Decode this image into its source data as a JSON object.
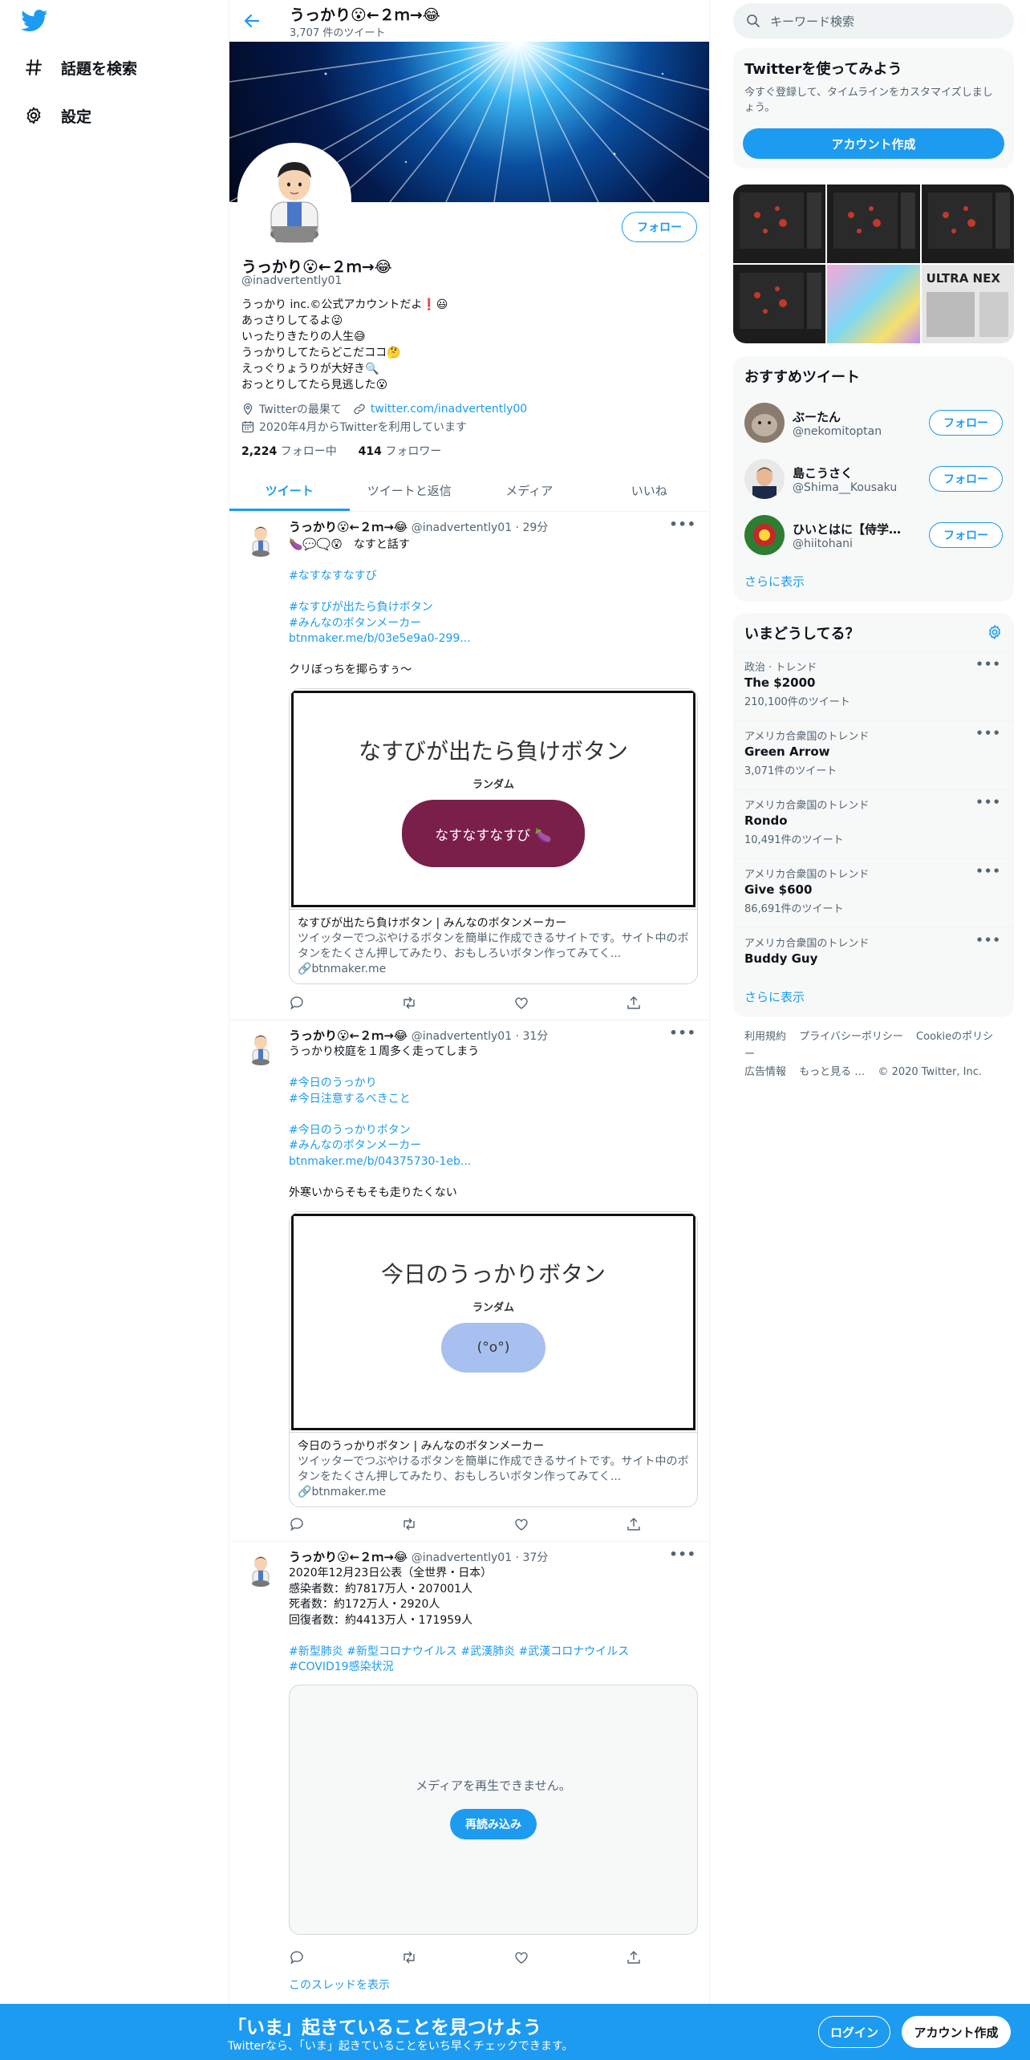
{
  "nav": {
    "items": [
      {
        "icon": "hashtag-icon",
        "label": "話題を検索"
      },
      {
        "icon": "gear-icon",
        "label": "設定"
      }
    ]
  },
  "topbar": {
    "title": "うっかり😮←２ｍ→😂",
    "subtitle": "3,707 件のツイート"
  },
  "profile": {
    "name": "うっかり😮←２ｍ→😂",
    "handle": "@inadvertently01",
    "follow_label": "フォロー",
    "bio": "うっかり inc.©公式アカウントだよ❗😃\nあっさりしてるよ😜\nいったりきたりの人生😅\nうっかりしてたらどこだココ🤔\nえっぐりょうりが大好き🔍\nおっとりしてたら見逃した😮",
    "location": "Twitterの最果て",
    "url": "twitter.com/inadvertently00",
    "joined": "2020年4月からTwitterを利用しています",
    "following_count": "2,224",
    "following_label": "フォロー中",
    "followers_count": "414",
    "followers_label": "フォロワー"
  },
  "tabs": [
    "ツイート",
    "ツイートと返信",
    "メディア",
    "いいね"
  ],
  "tweets": [
    {
      "name": "うっかり😮←２ｍ→😂",
      "handle": "@inadvertently01",
      "time": "29分",
      "text": "🍆💬🗨️😲　なすと話す\n\n#なすなすなすび\n\n#なすびが出たら負けボタン\n#みんなのボタンメーカー\n btnmaker.me/b/03e5e9a0-299...\n\nクリぼっちを揶らすぅ～",
      "card": {
        "image_title": "なすびが出たら負けボタン",
        "image_label": "ランダム",
        "button_text": "なすなすなすび 🍆",
        "title": "なすびが出たら負けボタン | みんなのボタンメーカー",
        "desc": "ツイッターでつぶやけるボタンを簡単に作成できるサイトです。サイト中のボタンをたくさん押してみたり、おもしろいボタン作ってみてく...",
        "domain": "btnmaker.me"
      }
    },
    {
      "name": "うっかり😮←２ｍ→😂",
      "handle": "@inadvertently01",
      "time": "31分",
      "text": "うっかり校庭を１周多く走ってしまう\n\n#今日のうっかり\n#今日注意するべきこと\n\n#今日のうっかりボタン\n#みんなのボタンメーカー\n btnmaker.me/b/04375730-1eb...\n\n外寒いからそもそも走りたくない",
      "card": {
        "image_title": "今日のうっかりボタン",
        "image_label": "ランダム",
        "button_text": "(°o°)",
        "title": "今日のうっかりボタン | みんなのボタンメーカー",
        "desc": "ツイッターでつぶやけるボタンを簡単に作成できるサイトです。サイト中のボタンをたくさん押してみたり、おもしろいボタン作ってみてく...",
        "domain": "btnmaker.me"
      }
    },
    {
      "name": "うっかり😮←２ｍ→😂",
      "handle": "@inadvertently01",
      "time": "37分",
      "text": "2020年12月23日公表（全世界・日本）\n感染者数：約7817万人・207001人\n死者数：約172万人・2920人\n回復者数：約4413万人・171959人\n\n#新型肺炎 #新型コロナウイルス #武漢肺炎 #武漢コロナウイルス\n#COVID19感染状況",
      "video_error": "メディアを再生できません。",
      "video_reload": "再読み込み",
      "show_thread": "このスレッドを表示"
    }
  ],
  "sidebar": {
    "search_placeholder": "キーワード検索",
    "signup_panel": {
      "title": "Twitterを使ってみよう",
      "text": "今すぐ登録して、タイムラインをカスタマイズしましょう。",
      "button": "アカウント作成"
    },
    "media_tiles": [
      "map",
      "map",
      "map",
      "map",
      "anime",
      "ULTRA NEX"
    ],
    "recommended": {
      "title": "おすすめツイート",
      "users": [
        {
          "name": "ぶーたん",
          "handle": "@nekomitoptan",
          "follow": "フォロー"
        },
        {
          "name": "島こうさく",
          "handle": "@Shima__Kousaku",
          "follow": "フォロー"
        },
        {
          "name": "ひいとはに【侍学・...",
          "handle": "@hiitohani",
          "follow": "フォロー"
        }
      ],
      "more": "さらに表示"
    },
    "trends": {
      "title": "いまどうしてる？",
      "items": [
        {
          "context": "政治 · トレンド",
          "name": "The $2000",
          "count": "210,100件のツイート"
        },
        {
          "context": "アメリカ合衆国のトレンド",
          "name": "Green Arrow",
          "count": "3,071件のツイート"
        },
        {
          "context": "アメリカ合衆国のトレンド",
          "name": "Rondo",
          "count": "10,491件のツイート"
        },
        {
          "context": "アメリカ合衆国のトレンド",
          "name": "Give $600",
          "count": "86,691件のツイート"
        },
        {
          "context": "アメリカ合衆国のトレンド",
          "name": "Buddy Guy",
          "count": ""
        }
      ],
      "more": "さらに表示"
    },
    "footer": {
      "links": [
        "利用規約",
        "プライバシーポリシー",
        "Cookieのポリシー",
        "広告情報",
        "もっと見る …"
      ],
      "copyright": "© 2020 Twitter, Inc."
    }
  },
  "bottombar": {
    "title": "「いま」起きていることを見つけよう",
    "subtitle": "Twitterなら、「いま」起きていることをいち早くチェックできます。",
    "login": "ログイン",
    "signup": "アカウント作成"
  },
  "colors": {
    "accent": "#1d9bf0",
    "eggplant_button": "#7a1f4a",
    "blue_button": "#a8c0f0"
  }
}
